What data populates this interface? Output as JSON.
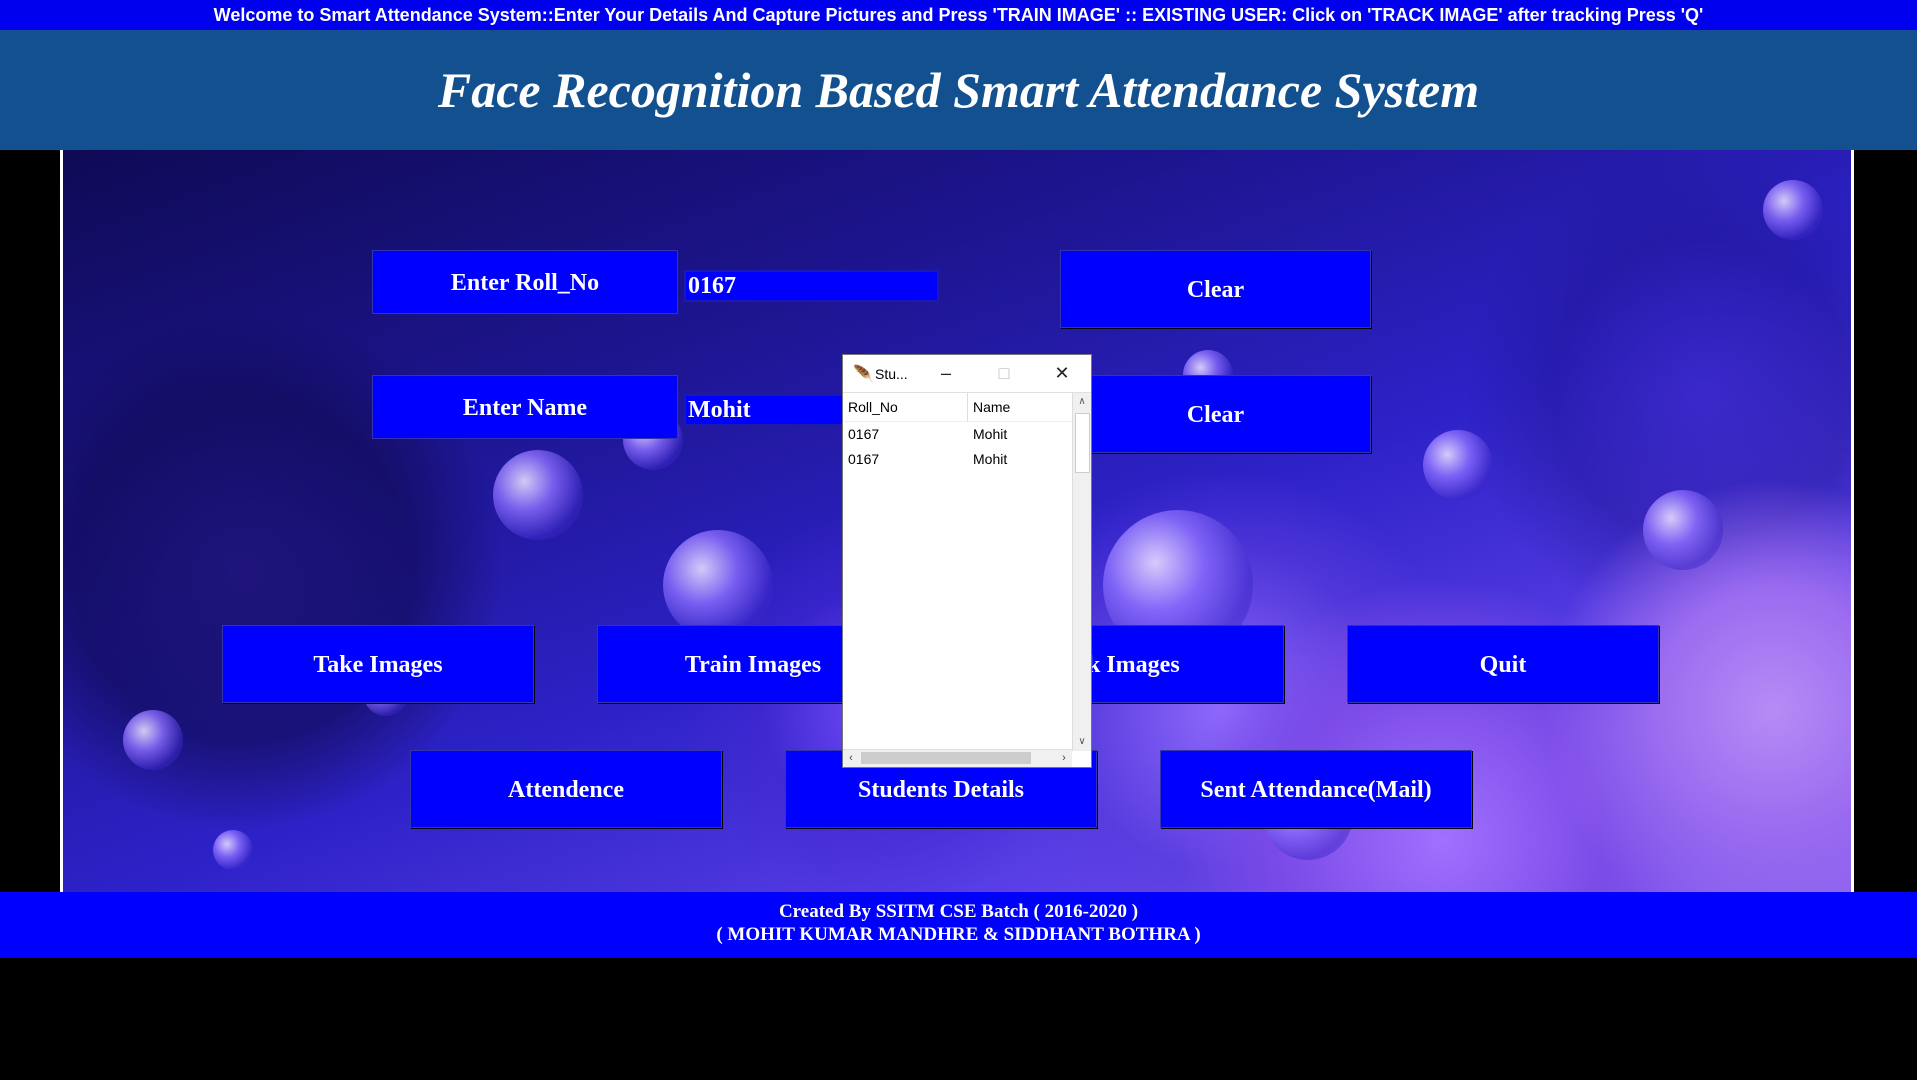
{
  "marquee": "Welcome to Smart Attendance System::Enter Your Details And Capture Pictures and Press 'TRAIN IMAGE' :: EXISTING USER: Click on 'TRACK IMAGE' after tracking Press 'Q'",
  "title": "Face Recognition Based Smart Attendance System",
  "form": {
    "roll_label": "Enter Roll_No",
    "roll_value": "0167",
    "name_label": "Enter Name",
    "name_value": "Mohit",
    "clear1": "Clear",
    "clear2": "Clear"
  },
  "buttons": {
    "take": "Take Images",
    "train": "Train Images",
    "track": "ck Images",
    "quit": "Quit",
    "attendance": "Attendence",
    "students": "Students Details",
    "mail": "Sent Attendance(Mail)"
  },
  "footer": {
    "line1": "Created By SSITM CSE Batch ( 2016-2020 )",
    "line2": "( MOHIT KUMAR MANDHRE & SIDDHANT BOTHRA )"
  },
  "popup": {
    "title": "Stu...",
    "icon": "feather-icon",
    "columns": [
      "Roll_No",
      "Name"
    ],
    "rows": [
      {
        "roll": "0167",
        "name": "Mohit"
      },
      {
        "roll": "0167",
        "name": "Mohit"
      }
    ]
  },
  "colors": {
    "accent": "#0000ff",
    "title_bg": "#12508f",
    "marquee_bg": "#0000ee"
  }
}
